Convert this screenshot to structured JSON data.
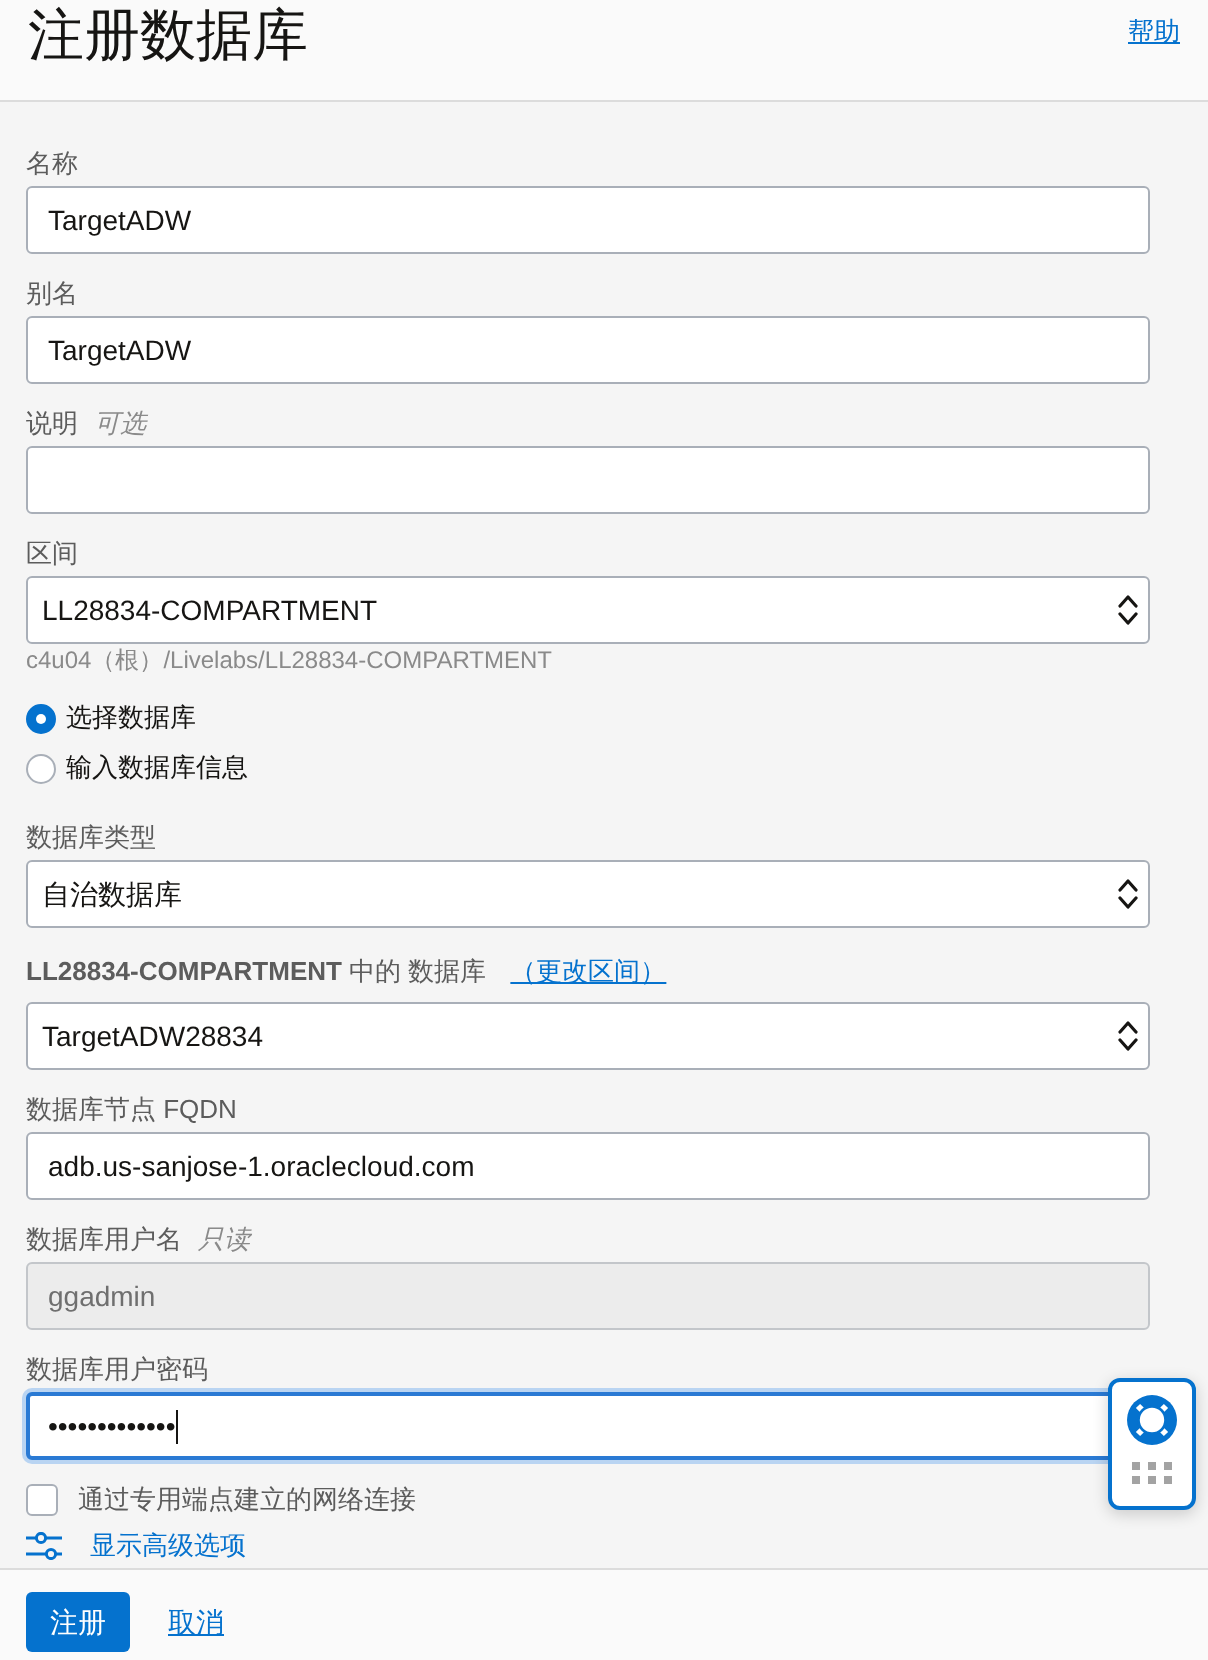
{
  "header": {
    "title": "注册数据库",
    "help_link": "帮助"
  },
  "form": {
    "fields": [
      {
        "kind": "text",
        "label": "名称",
        "value": "TargetADW",
        "disabled": false,
        "focused": false
      },
      {
        "kind": "text",
        "label": "别名",
        "value": "TargetADW",
        "disabled": false,
        "focused": false
      },
      {
        "kind": "text",
        "label": "说明",
        "hint": "可选",
        "disabled": false,
        "focused": false
      },
      {
        "kind": "select",
        "label": "区间",
        "value": "LL28834-COMPARTMENT",
        "help": "c4u04（根）/Livelabs/LL28834-COMPARTMENT"
      },
      {
        "kind": "radio_group",
        "options": [
          {
            "label": "选择数据库",
            "selected": true
          },
          {
            "label": "输入数据库信息",
            "selected": false
          }
        ]
      },
      {
        "kind": "select",
        "label": "数据库类型",
        "value": "自治数据库"
      },
      {
        "kind": "select",
        "label": "**LL28834-COMPARTMENT** 中的 数据库",
        "label_link": "（更改区间）",
        "value": "TargetADW28834"
      },
      {
        "kind": "text",
        "label": "数据库节点 FQDN",
        "value": "adb.us-sanjose-1.oraclecloud.com",
        "disabled": false,
        "focused": false
      },
      {
        "kind": "text",
        "label": "数据库用户名",
        "hint": "只读",
        "value": "ggadmin",
        "disabled": true,
        "focused": false
      },
      {
        "kind": "text",
        "label": "数据库用户密码",
        "value": "•••••••••••••",
        "disabled": false,
        "focused": true
      },
      {
        "kind": "checkbox",
        "label": "通过专用端点建立的网络连接",
        "checked": false
      },
      {
        "kind": "link",
        "label": "显示高级选项"
      }
    ]
  },
  "footer": {
    "buttons": [
      {
        "kind": "primary",
        "label": "注册"
      },
      {
        "kind": "link",
        "label": "取消"
      }
    ]
  }
}
